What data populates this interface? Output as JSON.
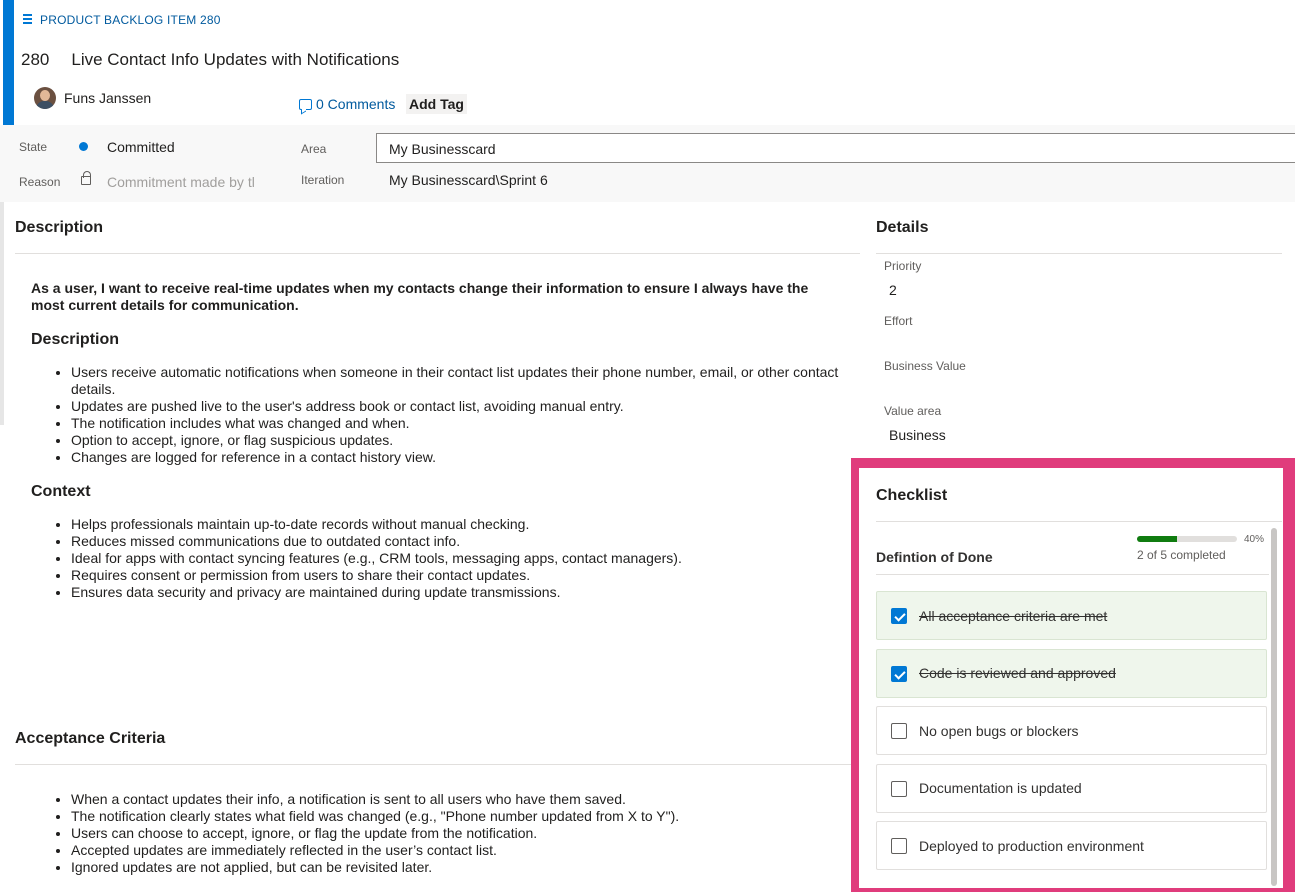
{
  "work_item": {
    "type_label": "PRODUCT BACKLOG ITEM 280",
    "id": "280",
    "title": "Live Contact Info Updates with Notifications",
    "assignee": "Funs Janssen",
    "comments": "0 Comments",
    "add_tag": "Add Tag"
  },
  "fields": {
    "state_label": "State",
    "state_value": "Committed",
    "state_color": "#0078d4",
    "reason_label": "Reason",
    "reason_value": "Commitment made by tl",
    "area_label": "Area",
    "area_value": "My Businesscard",
    "iteration_label": "Iteration",
    "iteration_value": "My Businesscard\\Sprint 6"
  },
  "description": {
    "heading": "Description",
    "lead": "As a user, I want to receive real-time updates when my contacts change their information to ensure I always have the most current details for communication.",
    "sub1": "Description",
    "bullets1": [
      "Users receive automatic notifications when someone in their contact list updates their phone number, email, or other contact details.",
      "Updates are pushed live to the user's address book or contact list, avoiding manual entry.",
      "The notification includes what was changed and when.",
      "Option to accept, ignore, or flag suspicious updates.",
      "Changes are logged for reference in a contact history view."
    ],
    "sub2": "Context",
    "bullets2": [
      "Helps professionals maintain up-to-date records without manual checking.",
      "Reduces missed communications due to outdated contact info.",
      "Ideal for apps with contact syncing features (e.g., CRM tools, messaging apps, contact managers).",
      "Requires consent or permission from users to share their contact updates.",
      "Ensures data security and privacy are maintained during update transmissions."
    ]
  },
  "acceptance": {
    "heading": "Acceptance Criteria",
    "bullets": [
      "When a contact updates their info, a notification is sent to all users who have them saved.",
      "The notification clearly states what field was changed (e.g., \"Phone number updated from X to Y\").",
      "Users can choose to accept, ignore, or flag the update from the notification.",
      "Accepted updates are immediately reflected in the user’s contact list.",
      "Ignored updates are not applied, but can be revisited later."
    ]
  },
  "details": {
    "heading": "Details",
    "priority_label": "Priority",
    "priority_value": "2",
    "effort_label": "Effort",
    "business_value_label": "Business Value",
    "value_area_label": "Value area",
    "value_area_value": "Business"
  },
  "checklist": {
    "heading": "Checklist",
    "group": "Defintion of Done",
    "progress_fraction": 0.4,
    "progress_pct": "40%",
    "progress_text": "2 of 5 completed",
    "progress_color": "#107c10",
    "highlight_color": "#e03c7c",
    "items": [
      {
        "label": "All acceptance criteria are met",
        "done": true
      },
      {
        "label": "Code is reviewed and approved",
        "done": true
      },
      {
        "label": "No open bugs or blockers",
        "done": false
      },
      {
        "label": "Documentation is updated",
        "done": false
      },
      {
        "label": "Deployed to production environment",
        "done": false
      }
    ]
  }
}
